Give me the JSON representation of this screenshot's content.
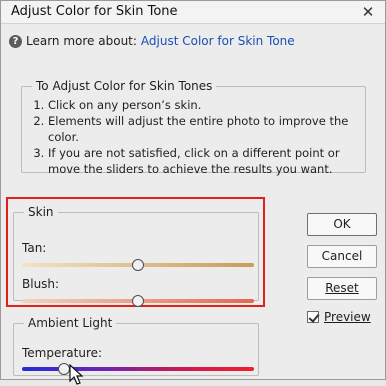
{
  "window": {
    "title": "Adjust Color for Skin Tone",
    "close_label": "✕"
  },
  "learn": {
    "prefix": "Learn more about:",
    "link": "Adjust Color for Skin Tone"
  },
  "instructions": {
    "title": "To Adjust Color for Skin Tones",
    "steps": [
      "Click on any person’s skin.",
      "Elements will adjust the entire photo to improve the color.",
      "If you are not satisfied, click on a different point or move the sliders to achieve the results you want."
    ]
  },
  "skin": {
    "title": "Skin",
    "tan": {
      "label": "Tan:",
      "level": 0.5
    },
    "blush": {
      "label": "Blush:",
      "level": 0.5
    }
  },
  "ambient": {
    "title": "Ambient Light",
    "temperature": {
      "label": "Temperature:",
      "level": 0.18
    }
  },
  "buttons": {
    "ok": "OK",
    "cancel": "Cancel",
    "reset": "Reset"
  },
  "preview": {
    "label": "Preview",
    "checked": true
  },
  "colors": {
    "link": "#1a4fb6",
    "highlight": "#e0201c"
  }
}
